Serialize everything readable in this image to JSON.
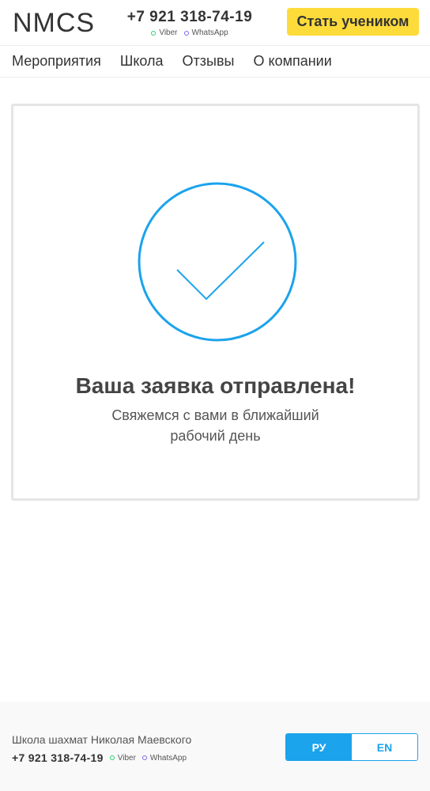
{
  "header": {
    "logo": "NMCS",
    "phone": "+7 921 318-74-19",
    "viber": "Viber",
    "whatsapp": "WhatsApp",
    "cta_label": "Стать учеником"
  },
  "nav": {
    "items": [
      {
        "label": "Мероприятия"
      },
      {
        "label": "Школа"
      },
      {
        "label": "Отзывы"
      },
      {
        "label": "О компании"
      }
    ]
  },
  "success": {
    "title": "Ваша заявка отправлена!",
    "subtitle": "Свяжемся с вами в ближайший рабочий день"
  },
  "footer": {
    "school_name": "Школа шахмат Николая Маевского",
    "phone": "+7 921 318-74-19",
    "viber": "Viber",
    "whatsapp": "WhatsApp",
    "lang_ru": "РУ",
    "lang_en": "EN"
  },
  "colors": {
    "accent": "#1ba3ec",
    "cta": "#fddb3a",
    "viber_dot": "#2ecc71",
    "whatsapp_dot": "#7b6be8"
  }
}
